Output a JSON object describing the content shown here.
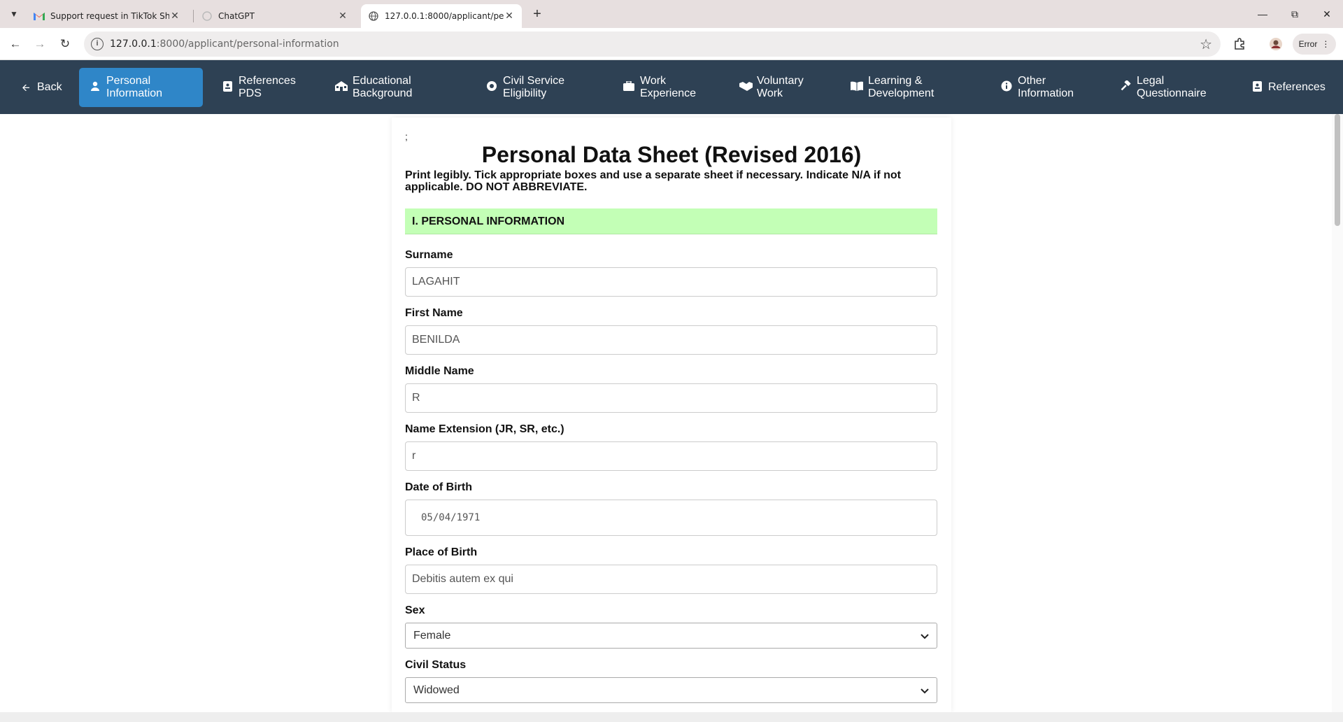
{
  "browser": {
    "tabs": [
      {
        "title": "Support request in TikTok Shop",
        "favicon": "gmail-icon"
      },
      {
        "title": "ChatGPT",
        "favicon": "chatgpt-icon"
      },
      {
        "title": "127.0.0.1:8000/applicant/perso",
        "favicon": "globe-icon"
      }
    ],
    "url_host": "127.0.0.1",
    "url_rest": ":8000/applicant/personal-information",
    "profile_status": "Error"
  },
  "nav": {
    "items": [
      {
        "label": "Back",
        "icon": "arrow-left-icon"
      },
      {
        "label": "Personal Information",
        "icon": "user-icon"
      },
      {
        "label": "References PDS",
        "icon": "contact-card-icon"
      },
      {
        "label": "Educational Background",
        "icon": "school-icon"
      },
      {
        "label": "Civil Service Eligibility",
        "icon": "certificate-icon"
      },
      {
        "label": "Work Experience",
        "icon": "briefcase-icon"
      },
      {
        "label": "Voluntary Work",
        "icon": "handshake-icon"
      },
      {
        "label": "Learning & Development",
        "icon": "book-icon"
      },
      {
        "label": "Other Information",
        "icon": "info-icon"
      },
      {
        "label": "Legal Questionnaire",
        "icon": "gavel-icon"
      },
      {
        "label": "References",
        "icon": "id-card-icon"
      }
    ],
    "active": "Personal Information"
  },
  "page": {
    "stray_text": ";",
    "title": "Personal Data Sheet (Revised 2016)",
    "instructions": "Print legibly. Tick appropriate boxes and use a separate sheet if necessary. Indicate N/A if not applicable. DO NOT ABBREVIATE.",
    "section": "I. PERSONAL INFORMATION"
  },
  "form": {
    "surname": {
      "label": "Surname",
      "value": "LAGAHIT"
    },
    "first_name": {
      "label": "First Name",
      "value": "BENILDA"
    },
    "middle_name": {
      "label": "Middle Name",
      "value": "R"
    },
    "name_extension": {
      "label": "Name Extension (JR, SR, etc.)",
      "value": "r"
    },
    "date_of_birth": {
      "label": "Date of Birth",
      "value": "05/04/1971"
    },
    "place_of_birth": {
      "label": "Place of Birth",
      "value": "Debitis autem ex qui"
    },
    "sex": {
      "label": "Sex",
      "value": "Female"
    },
    "civil_status": {
      "label": "Civil Status",
      "value": "Widowed"
    }
  },
  "colors": {
    "navbar": "#2e4154",
    "nav_active": "#2f86c8",
    "section_bar": "#c3ffb6"
  }
}
